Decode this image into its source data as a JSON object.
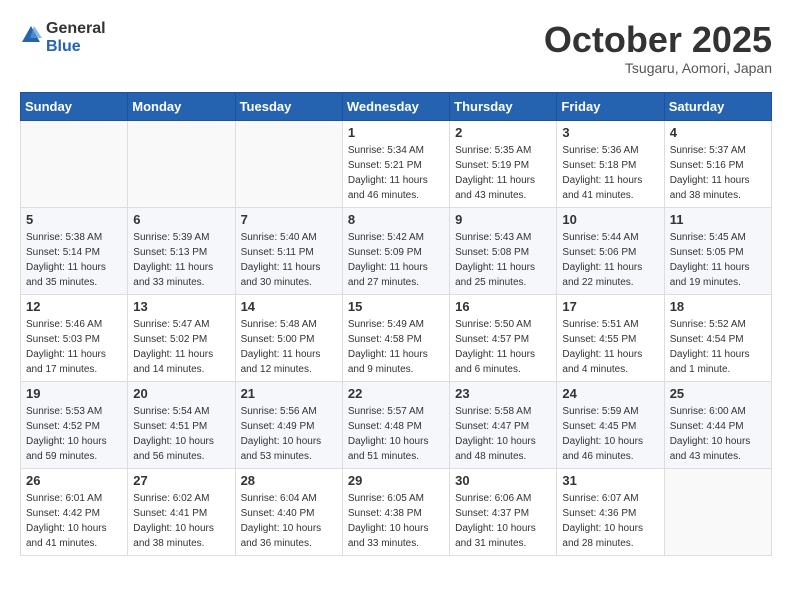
{
  "header": {
    "logo_general": "General",
    "logo_blue": "Blue",
    "month": "October 2025",
    "location": "Tsugaru, Aomori, Japan"
  },
  "weekdays": [
    "Sunday",
    "Monday",
    "Tuesday",
    "Wednesday",
    "Thursday",
    "Friday",
    "Saturday"
  ],
  "weeks": [
    [
      {
        "day": "",
        "info": ""
      },
      {
        "day": "",
        "info": ""
      },
      {
        "day": "",
        "info": ""
      },
      {
        "day": "1",
        "info": "Sunrise: 5:34 AM\nSunset: 5:21 PM\nDaylight: 11 hours\nand 46 minutes."
      },
      {
        "day": "2",
        "info": "Sunrise: 5:35 AM\nSunset: 5:19 PM\nDaylight: 11 hours\nand 43 minutes."
      },
      {
        "day": "3",
        "info": "Sunrise: 5:36 AM\nSunset: 5:18 PM\nDaylight: 11 hours\nand 41 minutes."
      },
      {
        "day": "4",
        "info": "Sunrise: 5:37 AM\nSunset: 5:16 PM\nDaylight: 11 hours\nand 38 minutes."
      }
    ],
    [
      {
        "day": "5",
        "info": "Sunrise: 5:38 AM\nSunset: 5:14 PM\nDaylight: 11 hours\nand 35 minutes."
      },
      {
        "day": "6",
        "info": "Sunrise: 5:39 AM\nSunset: 5:13 PM\nDaylight: 11 hours\nand 33 minutes."
      },
      {
        "day": "7",
        "info": "Sunrise: 5:40 AM\nSunset: 5:11 PM\nDaylight: 11 hours\nand 30 minutes."
      },
      {
        "day": "8",
        "info": "Sunrise: 5:42 AM\nSunset: 5:09 PM\nDaylight: 11 hours\nand 27 minutes."
      },
      {
        "day": "9",
        "info": "Sunrise: 5:43 AM\nSunset: 5:08 PM\nDaylight: 11 hours\nand 25 minutes."
      },
      {
        "day": "10",
        "info": "Sunrise: 5:44 AM\nSunset: 5:06 PM\nDaylight: 11 hours\nand 22 minutes."
      },
      {
        "day": "11",
        "info": "Sunrise: 5:45 AM\nSunset: 5:05 PM\nDaylight: 11 hours\nand 19 minutes."
      }
    ],
    [
      {
        "day": "12",
        "info": "Sunrise: 5:46 AM\nSunset: 5:03 PM\nDaylight: 11 hours\nand 17 minutes."
      },
      {
        "day": "13",
        "info": "Sunrise: 5:47 AM\nSunset: 5:02 PM\nDaylight: 11 hours\nand 14 minutes."
      },
      {
        "day": "14",
        "info": "Sunrise: 5:48 AM\nSunset: 5:00 PM\nDaylight: 11 hours\nand 12 minutes."
      },
      {
        "day": "15",
        "info": "Sunrise: 5:49 AM\nSunset: 4:58 PM\nDaylight: 11 hours\nand 9 minutes."
      },
      {
        "day": "16",
        "info": "Sunrise: 5:50 AM\nSunset: 4:57 PM\nDaylight: 11 hours\nand 6 minutes."
      },
      {
        "day": "17",
        "info": "Sunrise: 5:51 AM\nSunset: 4:55 PM\nDaylight: 11 hours\nand 4 minutes."
      },
      {
        "day": "18",
        "info": "Sunrise: 5:52 AM\nSunset: 4:54 PM\nDaylight: 11 hours\nand 1 minute."
      }
    ],
    [
      {
        "day": "19",
        "info": "Sunrise: 5:53 AM\nSunset: 4:52 PM\nDaylight: 10 hours\nand 59 minutes."
      },
      {
        "day": "20",
        "info": "Sunrise: 5:54 AM\nSunset: 4:51 PM\nDaylight: 10 hours\nand 56 minutes."
      },
      {
        "day": "21",
        "info": "Sunrise: 5:56 AM\nSunset: 4:49 PM\nDaylight: 10 hours\nand 53 minutes."
      },
      {
        "day": "22",
        "info": "Sunrise: 5:57 AM\nSunset: 4:48 PM\nDaylight: 10 hours\nand 51 minutes."
      },
      {
        "day": "23",
        "info": "Sunrise: 5:58 AM\nSunset: 4:47 PM\nDaylight: 10 hours\nand 48 minutes."
      },
      {
        "day": "24",
        "info": "Sunrise: 5:59 AM\nSunset: 4:45 PM\nDaylight: 10 hours\nand 46 minutes."
      },
      {
        "day": "25",
        "info": "Sunrise: 6:00 AM\nSunset: 4:44 PM\nDaylight: 10 hours\nand 43 minutes."
      }
    ],
    [
      {
        "day": "26",
        "info": "Sunrise: 6:01 AM\nSunset: 4:42 PM\nDaylight: 10 hours\nand 41 minutes."
      },
      {
        "day": "27",
        "info": "Sunrise: 6:02 AM\nSunset: 4:41 PM\nDaylight: 10 hours\nand 38 minutes."
      },
      {
        "day": "28",
        "info": "Sunrise: 6:04 AM\nSunset: 4:40 PM\nDaylight: 10 hours\nand 36 minutes."
      },
      {
        "day": "29",
        "info": "Sunrise: 6:05 AM\nSunset: 4:38 PM\nDaylight: 10 hours\nand 33 minutes."
      },
      {
        "day": "30",
        "info": "Sunrise: 6:06 AM\nSunset: 4:37 PM\nDaylight: 10 hours\nand 31 minutes."
      },
      {
        "day": "31",
        "info": "Sunrise: 6:07 AM\nSunset: 4:36 PM\nDaylight: 10 hours\nand 28 minutes."
      },
      {
        "day": "",
        "info": ""
      }
    ]
  ]
}
